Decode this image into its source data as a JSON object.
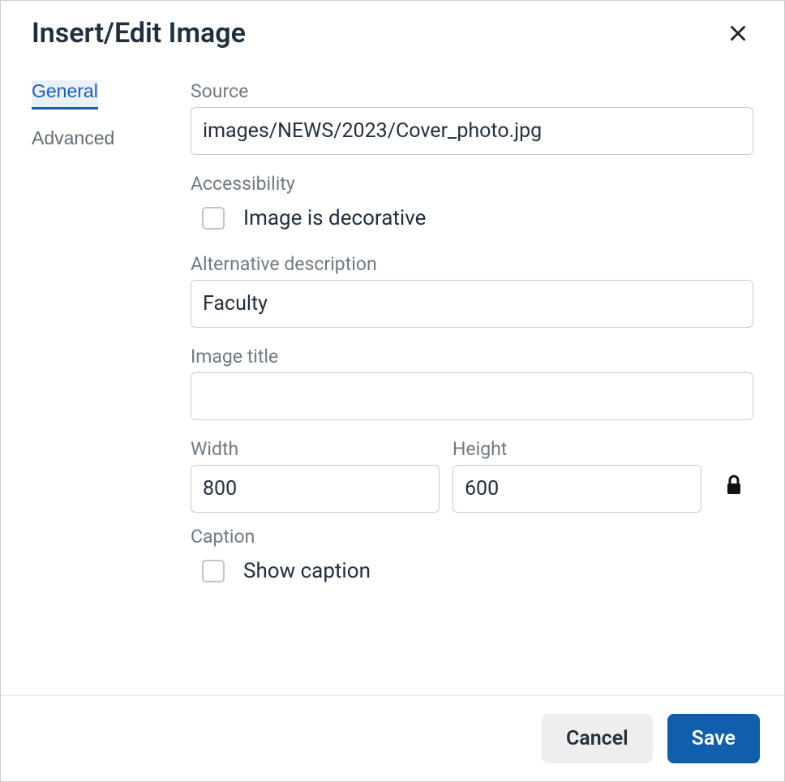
{
  "dialog": {
    "title": "Insert/Edit Image"
  },
  "tabs": {
    "general": "General",
    "advanced": "Advanced"
  },
  "labels": {
    "source": "Source",
    "accessibility": "Accessibility",
    "decorative": "Image is decorative",
    "alt": "Alternative description",
    "imageTitle": "Image title",
    "width": "Width",
    "height": "Height",
    "caption": "Caption",
    "showCaption": "Show caption"
  },
  "values": {
    "source": "images/NEWS/2023/Cover_photo.jpg",
    "alt": "Faculty",
    "imageTitle": "",
    "width": "800",
    "height": "600"
  },
  "buttons": {
    "cancel": "Cancel",
    "save": "Save"
  }
}
